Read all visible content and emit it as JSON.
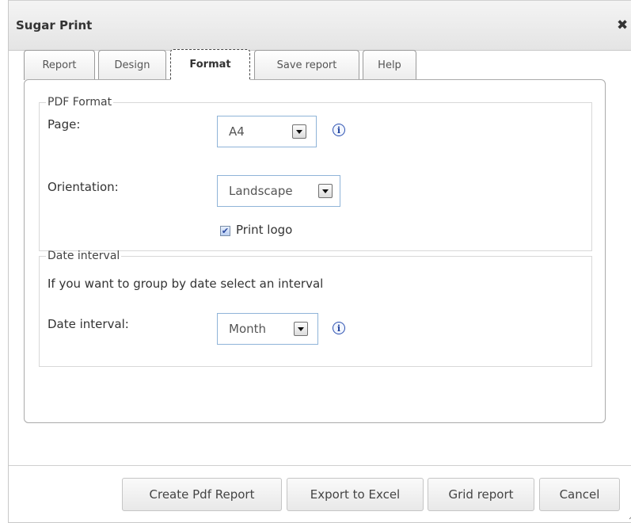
{
  "dialog": {
    "title": "Sugar Print",
    "close_icon": "close-icon"
  },
  "tabs": [
    {
      "label": "Report",
      "active": false
    },
    {
      "label": "Design",
      "active": false
    },
    {
      "label": "Format",
      "active": true
    },
    {
      "label": "Save report",
      "active": false
    },
    {
      "label": "Help",
      "active": false
    }
  ],
  "pdf_format": {
    "legend": "PDF Format",
    "page_label": "Page:",
    "page_value": "A4",
    "orientation_label": "Orientation:",
    "orientation_value": "Landscape",
    "print_logo_label": "Print logo",
    "print_logo_checked": true
  },
  "date_interval": {
    "legend": "Date interval",
    "hint": "If you want to group by date select an interval",
    "label": "Date interval:",
    "value": "Month"
  },
  "buttons": {
    "create_pdf": "Create Pdf Report",
    "export_excel": "Export to Excel",
    "grid_report": "Grid report",
    "cancel": "Cancel"
  },
  "colors": {
    "accent_border": "#8fb4d8",
    "info_icon": "#2b50b0"
  }
}
